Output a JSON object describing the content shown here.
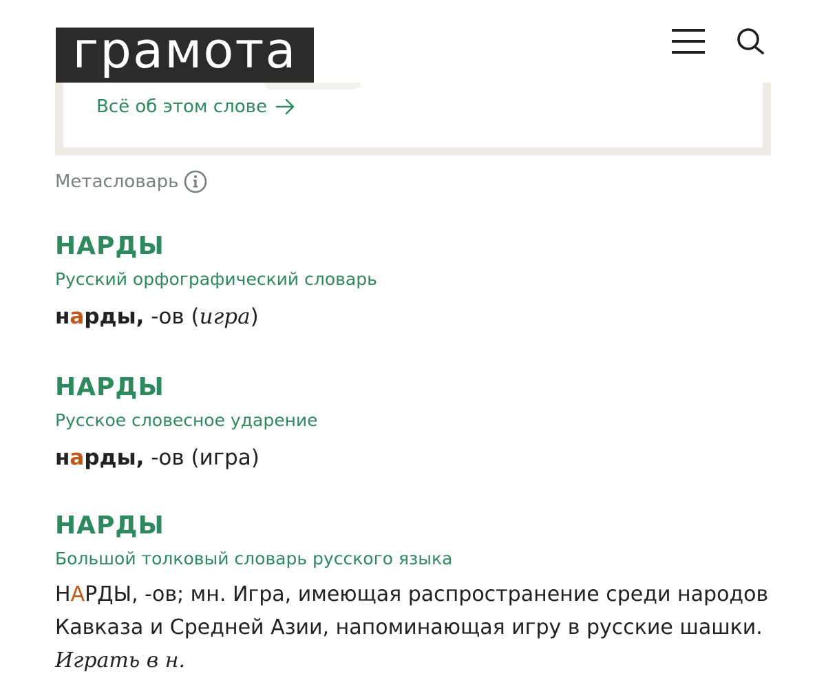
{
  "header": {
    "logo": "грамота",
    "menu_icon": "hamburger-menu-icon",
    "search_icon": "search-icon"
  },
  "card": {
    "link_label": "Всё об этом слове",
    "link_icon": "arrow-right-icon"
  },
  "metaslovar": {
    "label": "Метасловарь",
    "icon": "info-icon"
  },
  "entries": [
    {
      "title": "НАРДЫ",
      "source": "Русский орфографический словарь",
      "head_pre": "н",
      "head_stress": "а",
      "head_post": "рды,",
      "text_main": " -ов (",
      "text_italic": "игра",
      "text_end": ")"
    },
    {
      "title": "НАРДЫ",
      "source": "Русское словесное ударение",
      "head_pre": "н",
      "head_stress": "а",
      "head_post": "рды,",
      "text_main": " -ов (игра)"
    },
    {
      "title": "НАРДЫ",
      "source": "Большой толковый словарь русского языка",
      "head_pre": "Н",
      "head_stress": "А",
      "head_post": "РДЫ",
      "text_main": ", -ов; мн. Игра, имеющая распространение среди народов Кавказа и Средней Азии, напоминающая игру в русские шашки. ",
      "text_italic": "Играть в н."
    }
  ],
  "colors": {
    "accent": "#2e8a5e",
    "stress": "#c0581a",
    "logo_bg": "#2b2b2b",
    "muted": "#7a7f82",
    "card_border": "#eeece4"
  }
}
